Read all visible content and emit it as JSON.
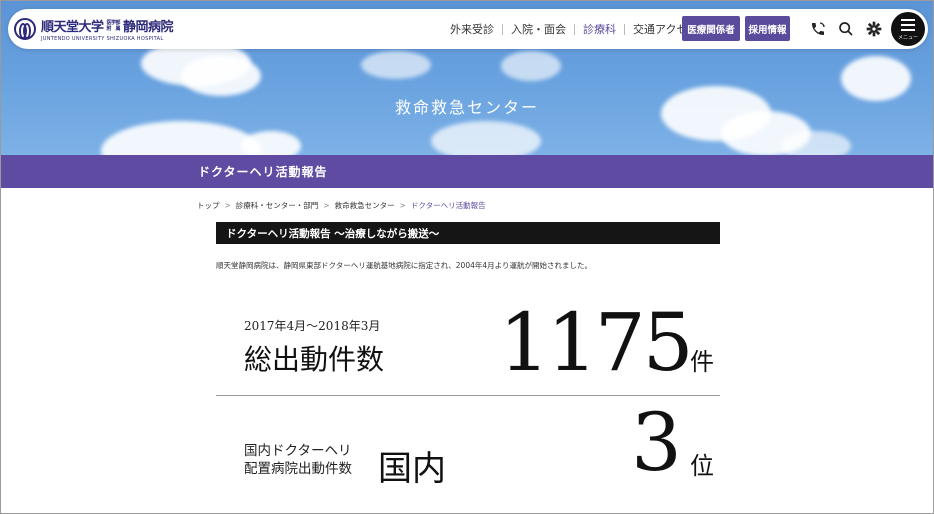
{
  "header": {
    "logo": {
      "main": "順天堂大学",
      "small_top": "医学部",
      "small_bottom": "附　属",
      "hospital": "静岡病院",
      "english": "JUNTENDO UNIVERSITY SHIZUOKA HOSPITAL"
    },
    "nav": [
      {
        "label": "外来受診",
        "active": false
      },
      {
        "label": "入院・面会",
        "active": false
      },
      {
        "label": "診療科",
        "active": true
      },
      {
        "label": "交通アクセス",
        "active": false
      }
    ],
    "buttons": {
      "medical": "医療関係者",
      "recruit": "採用情報"
    },
    "icons": [
      "phone-icon",
      "search-icon",
      "gear-icon"
    ],
    "menu_label": "メニュー"
  },
  "hero": {
    "title": "救命救急センター"
  },
  "band": {
    "title": "ドクターヘリ活動報告"
  },
  "breadcrumb": {
    "items": [
      "トップ",
      "診療科・センター・部門",
      "救命救急センター",
      "ドクターヘリ活動報告"
    ]
  },
  "section": {
    "heading": "ドクターヘリ活動報告 〜治療しながら搬送〜",
    "intro": "順天堂静岡病院は、静岡県東部ドクターヘリ運航基地病院に指定され、2004年4月より運航が開始されました。"
  },
  "stats": {
    "total": {
      "period": "2017年4月〜2018年3月",
      "label": "総出動件数",
      "value": "1175",
      "unit": "件"
    },
    "rank": {
      "label_line1": "国内ドクターヘリ",
      "label_line2": "配置病院出動件数",
      "label_big": "国内",
      "value": "3",
      "unit": "位"
    }
  },
  "colors": {
    "brand": "#2c2a7a",
    "accent": "#5f4ba2",
    "button": "#5a4b9c",
    "bar": "#151515"
  }
}
